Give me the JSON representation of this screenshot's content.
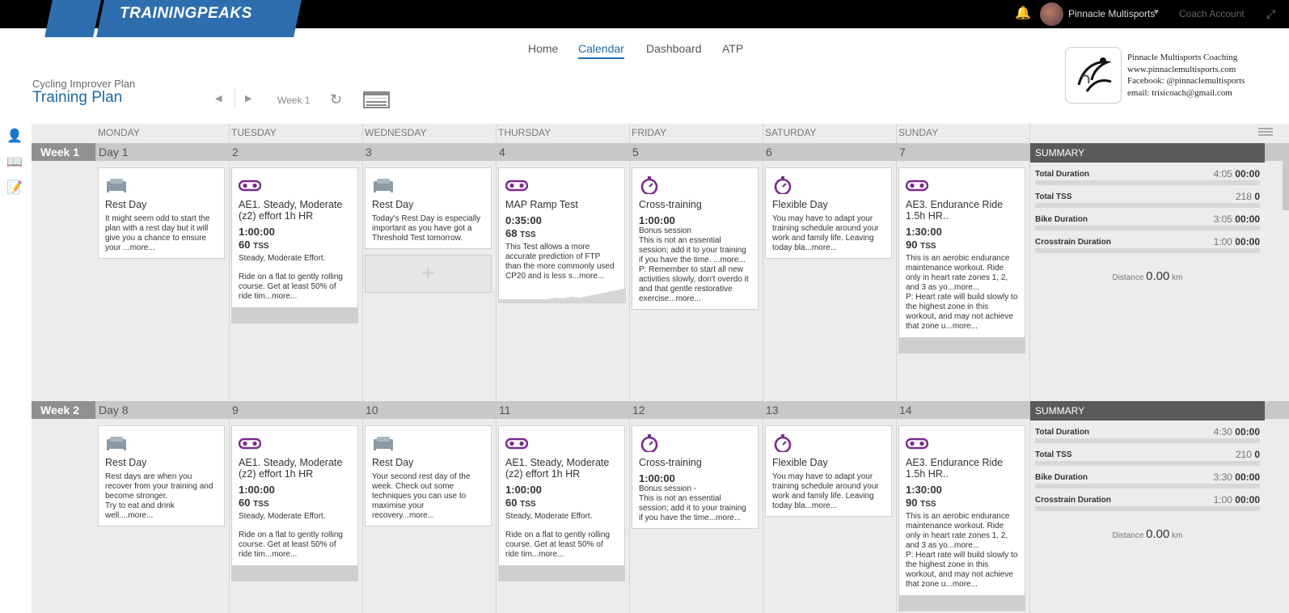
{
  "app": {
    "logo": "TRAININGPEAKS",
    "account_name": "Pinnacle Multisports",
    "coach_link": "Coach Account"
  },
  "nav": {
    "home": "Home",
    "calendar": "Calendar",
    "dashboard": "Dashboard",
    "atp": "ATP"
  },
  "plan": {
    "subtitle": "Cycling Improver Plan",
    "title": "Training Plan",
    "week_label": "Week 1"
  },
  "coach": {
    "name": "Pinnacle Multisports Coaching",
    "website": "www.pinnaclemultisports.com",
    "facebook": "Facebook: @pinnaclemultisports",
    "email": "email: trisicoach@gmail.com"
  },
  "days": [
    "MONDAY",
    "TUESDAY",
    "WEDNESDAY",
    "THURSDAY",
    "FRIDAY",
    "SATURDAY",
    "SUNDAY"
  ],
  "weeks": [
    {
      "label": "Week 1",
      "nums": [
        "Day 1",
        "2",
        "3",
        "4",
        "5",
        "6",
        "7"
      ],
      "cards": [
        {
          "title": "Rest Day",
          "desc": "It might seem odd to start the plan with a rest day but it will give you a chance to ensure your ...more..."
        },
        {
          "title": "AE1. Steady, Moderate (z2) effort 1h HR",
          "dur": "1:00:00",
          "tss": "60",
          "desc": "Steady, Moderate Effort.",
          "desc2": "Ride on a flat to gently rolling course. Get at least 50% of ride tim...more..."
        },
        {
          "title": "Rest Day",
          "desc": "Today's Rest Day is especially important as you have got a Threshold Test tomorrow."
        },
        {
          "title": "MAP Ramp Test",
          "dur": "0:35:00",
          "tss": "68",
          "desc": "This Test allows a more accurate prediction of FTP than the more commonly used CP20 and is less s...more..."
        },
        {
          "title": "Cross-training",
          "dur": "1:00:00",
          "desc": "Bonus session",
          "desc2": "This is not an essential session; add it to your training if you have the time. ...more...",
          "desc3": "P: Remember to start all new activities slowly, don't overdo it and that gentle restorative exercise...more..."
        },
        {
          "title": "Flexible Day",
          "desc": "You may have to adapt your training schedule around your work and family life. Leaving today bla...more..."
        },
        {
          "title": "AE3. Endurance Ride 1.5h HR..",
          "dur": "1:30:00",
          "tss": "90",
          "desc": "This is an aerobic endurance maintenance workout. Ride only in heart rate zones 1, 2, and 3 as yo...more...",
          "desc2": "P: Heart rate will build slowly to the highest zone in this workout, and may not achieve that zone u...more..."
        }
      ],
      "summary": {
        "title": "SUMMARY",
        "total_duration": "4:05",
        "total_tss": "218",
        "bike_duration": "3:05",
        "crosstrain_duration": "1:00",
        "distance": "0.00"
      }
    },
    {
      "label": "Week 2",
      "nums": [
        "Day 8",
        "9",
        "10",
        "11",
        "12",
        "13",
        "14"
      ],
      "cards": [
        {
          "title": "Rest Day",
          "desc": "Rest days are when you recover from your training and become stronger.",
          "desc2": "Try to eat and drink well....more..."
        },
        {
          "title": "AE1. Steady, Moderate (z2) effort 1h HR",
          "dur": "1:00:00",
          "tss": "60",
          "desc": "Steady, Moderate Effort.",
          "desc2": "Ride on a flat to gently rolling course. Get at least 50% of ride tim...more..."
        },
        {
          "title": "Rest Day",
          "desc": "Your second rest day of the week. Check out some techniques you can use to maximise your recovery...more..."
        },
        {
          "title": "AE1. Steady, Moderate (z2) effort 1h HR",
          "dur": "1:00:00",
          "tss": "60",
          "desc": "Steady, Moderate Effort.",
          "desc2": "Ride on a flat to gently rolling course. Get at least 50% of ride tim...more..."
        },
        {
          "title": "Cross-training",
          "dur": "1:00:00",
          "desc": "Bonus session -",
          "desc2": "This is not an essential session; add it to your training if you have the time...more..."
        },
        {
          "title": "Flexible Day",
          "desc": "You may have to adapt your training schedule around your work and family life. Leaving today bla...more..."
        },
        {
          "title": "AE3. Endurance Ride 1.5h HR..",
          "dur": "1:30:00",
          "tss": "90",
          "desc": "This is an aerobic endurance maintenance workout. Ride only in heart rate zones 1, 2, and 3 as yo...more...",
          "desc2": "P: Heart rate will build slowly to the highest zone in this workout, and may not achieve that zone u...more..."
        }
      ],
      "summary": {
        "title": "SUMMARY",
        "total_duration": "4:30",
        "total_tss": "210",
        "bike_duration": "3:30",
        "crosstrain_duration": "1:00",
        "distance": "0.00"
      }
    }
  ],
  "summary_labels": {
    "total_duration": "Total Duration",
    "total_tss": "Total TSS",
    "bike_duration": "Bike Duration",
    "crosstrain_duration": "Crosstrain Duration",
    "distance": "Distance",
    "km": "km",
    "zero_time": "00:00",
    "zero_tss": "0"
  },
  "tss_unit": "TSS",
  "colors": {
    "brand": "#2f6eae",
    "accent": "#1f6aa5",
    "workout_icon": "#7b2a8c"
  },
  "icons": {
    "rest": "bed-icon",
    "bike": "bike-icon",
    "cross": "stopwatch-icon"
  }
}
